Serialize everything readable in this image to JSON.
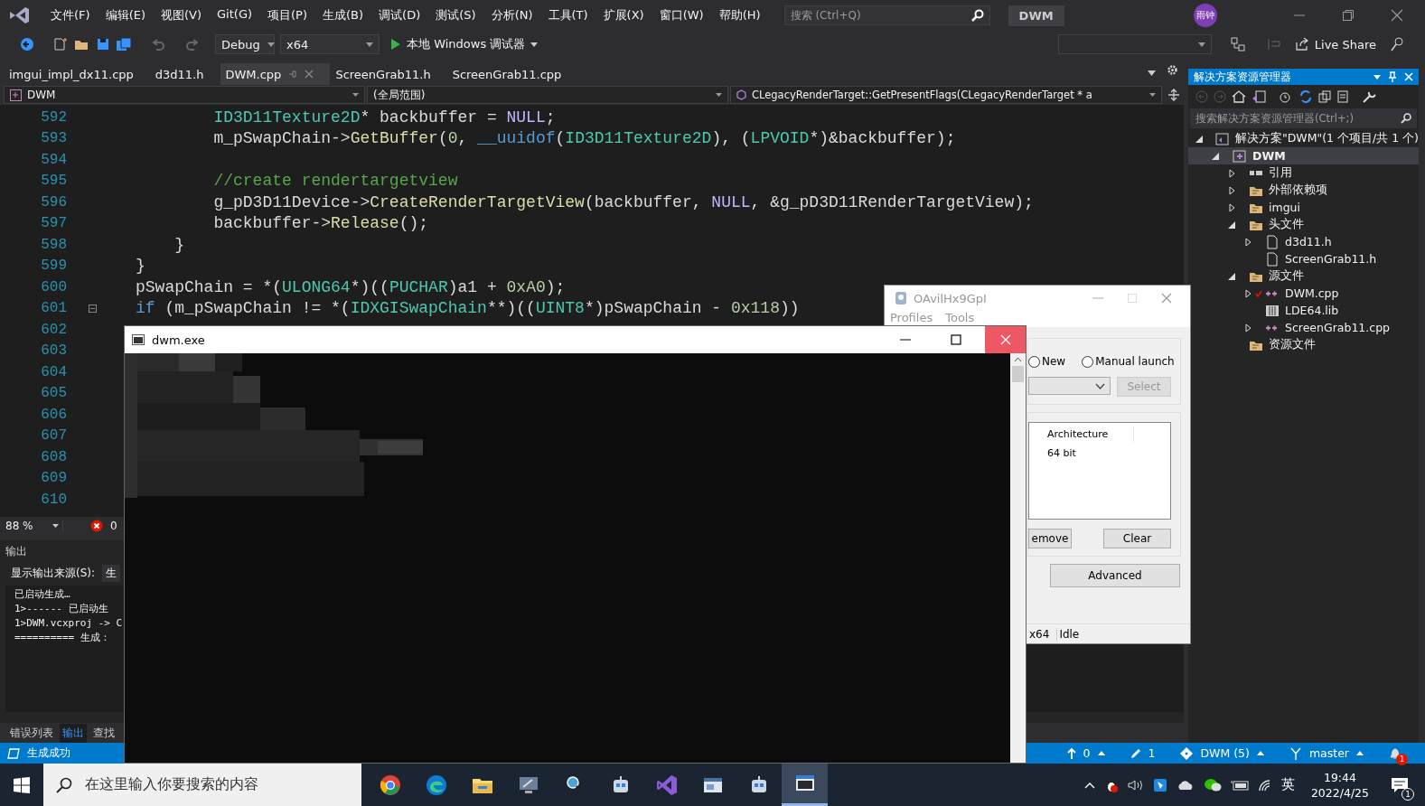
{
  "menu": [
    "文件(F)",
    "编辑(E)",
    "视图(V)",
    "Git(G)",
    "项目(P)",
    "生成(B)",
    "调试(D)",
    "测试(S)",
    "分析(N)",
    "工具(T)",
    "扩展(X)",
    "窗口(W)",
    "帮助(H)"
  ],
  "search": {
    "placeholder": "搜索 (Ctrl+Q)"
  },
  "solution_name": "DWM",
  "user_badge": "雨钟",
  "toolbar": {
    "configuration": "Debug",
    "platform": "x64",
    "run": "本地 Windows 调试器",
    "live_share": "Live Share"
  },
  "tabs": [
    {
      "label": "imgui_impl_dx11.cpp",
      "selected": false
    },
    {
      "label": "d3d11.h",
      "selected": false
    },
    {
      "label": "DWM.cpp",
      "selected": true
    },
    {
      "label": "ScreenGrab11.h",
      "selected": false
    },
    {
      "label": "ScreenGrab11.cpp",
      "selected": false
    }
  ],
  "nav": {
    "project": "DWM",
    "scope": "(全局范围)",
    "member": "CLegacyRenderTarget::GetPresentFlags(CLegacyRenderTarget * a"
  },
  "code": [
    {
      "number": "592",
      "segments": [
        {
          "kind": "type",
          "text": "        ID3D11Texture2D"
        },
        {
          "kind": "plain",
          "text": "* "
        },
        {
          "kind": "var",
          "text": "backbuffer"
        },
        {
          "kind": "plain",
          "text": " = "
        },
        {
          "kind": "macro",
          "text": "NULL"
        },
        {
          "kind": "plain",
          "text": ";"
        }
      ]
    },
    {
      "number": "593",
      "segments": [
        {
          "kind": "var",
          "text": "        m_pSwapChain"
        },
        {
          "kind": "plain",
          "text": "->"
        },
        {
          "kind": "fn",
          "text": "GetBuffer"
        },
        {
          "kind": "plain",
          "text": "("
        },
        {
          "kind": "num",
          "text": "0"
        },
        {
          "kind": "plain",
          "text": ", "
        },
        {
          "kind": "kw",
          "text": "__uuidof"
        },
        {
          "kind": "plain",
          "text": "("
        },
        {
          "kind": "type",
          "text": "ID3D11Texture2D"
        },
        {
          "kind": "plain",
          "text": "), ("
        },
        {
          "kind": "type",
          "text": "LPVOID"
        },
        {
          "kind": "plain",
          "text": "*)&"
        },
        {
          "kind": "var",
          "text": "backbuffer"
        },
        {
          "kind": "plain",
          "text": ");"
        }
      ]
    },
    {
      "number": "594"
    },
    {
      "number": "595",
      "segments": [
        {
          "kind": "comment",
          "text": "        //create rendertargetview"
        }
      ]
    },
    {
      "number": "596",
      "segments": [
        {
          "kind": "var",
          "text": "        g_pD3D11Device"
        },
        {
          "kind": "plain",
          "text": "->"
        },
        {
          "kind": "fn",
          "text": "CreateRenderTargetView"
        },
        {
          "kind": "plain",
          "text": "("
        },
        {
          "kind": "var",
          "text": "backbuffer"
        },
        {
          "kind": "plain",
          "text": ", "
        },
        {
          "kind": "macro",
          "text": "NULL"
        },
        {
          "kind": "plain",
          "text": ", &"
        },
        {
          "kind": "var",
          "text": "g_pD3D11RenderTargetView"
        },
        {
          "kind": "plain",
          "text": ");"
        }
      ]
    },
    {
      "number": "597",
      "segments": [
        {
          "kind": "var",
          "text": "        backbuffer"
        },
        {
          "kind": "plain",
          "text": "->"
        },
        {
          "kind": "fn",
          "text": "Release"
        },
        {
          "kind": "plain",
          "text": "();"
        }
      ]
    },
    {
      "number": "598",
      "segments": [
        {
          "kind": "plain",
          "text": "    }"
        }
      ]
    },
    {
      "number": "599",
      "segments": [
        {
          "kind": "plain",
          "text": "}"
        }
      ]
    },
    {
      "number": "600",
      "segments": [
        {
          "kind": "var",
          "text": "pSwapChain"
        },
        {
          "kind": "plain",
          "text": " = *("
        },
        {
          "kind": "type",
          "text": "ULONG64"
        },
        {
          "kind": "plain",
          "text": "*)(("
        },
        {
          "kind": "type",
          "text": "PUCHAR"
        },
        {
          "kind": "plain",
          "text": ")"
        },
        {
          "kind": "var",
          "text": "a1"
        },
        {
          "kind": "plain",
          "text": " + "
        },
        {
          "kind": "num",
          "text": "0xA0"
        },
        {
          "kind": "plain",
          "text": ");"
        }
      ]
    },
    {
      "number": "601",
      "segments": [
        {
          "kind": "kw",
          "text": "if"
        },
        {
          "kind": "plain",
          "text": " ("
        },
        {
          "kind": "var",
          "text": "m_pSwapChain"
        },
        {
          "kind": "plain",
          "text": " != *("
        },
        {
          "kind": "type",
          "text": "IDXGISwapChain"
        },
        {
          "kind": "plain",
          "text": "**)(("
        },
        {
          "kind": "type",
          "text": "UINT8"
        },
        {
          "kind": "plain",
          "text": "*)"
        },
        {
          "kind": "var",
          "text": "pSwapChain"
        },
        {
          "kind": "plain",
          "text": " - "
        },
        {
          "kind": "num",
          "text": "0x118"
        },
        {
          "kind": "plain",
          "text": "))"
        }
      ]
    },
    {
      "number": "602"
    },
    {
      "number": "603"
    },
    {
      "number": "604"
    },
    {
      "number": "605"
    },
    {
      "number": "606"
    },
    {
      "number": "607"
    },
    {
      "number": "608"
    },
    {
      "number": "609"
    },
    {
      "number": "610"
    }
  ],
  "zoom": "88 %",
  "errors": "0",
  "output": {
    "title": "输出",
    "source_label": "显示输出来源(S):",
    "source": "生",
    "lines": [
      "已启动生成…",
      "1>------ 已启动生",
      "1>DWM.vcxproj -> C",
      "========== 生成："
    ]
  },
  "bottom_tabs": [
    {
      "label": "错误列表",
      "selected": false
    },
    {
      "label": "输出",
      "selected": true
    },
    {
      "label": "查找",
      "selected": false
    }
  ],
  "status_bar": {
    "message": "生成成功",
    "push": "0",
    "changes": "1",
    "repo": "DWM (5)",
    "branch": "master",
    "notifications": "1"
  },
  "explorer": {
    "title": "解决方案资源管理器",
    "search": {
      "placeholder": "搜索解决方案资源管理器(Ctrl+;)"
    },
    "tree": [
      {
        "label": "解决方案\"DWM\"(1 个项目/共 1 个)",
        "kind": "solution",
        "expanded": true,
        "selected": false,
        "children": [
          {
            "label": "DWM",
            "kind": "project",
            "expanded": true,
            "selected": true,
            "children": [
              {
                "label": "引用",
                "kind": "references",
                "expanded": false,
                "selected": false
              },
              {
                "label": "外部依赖项",
                "kind": "folder",
                "expanded": false,
                "selected": false
              },
              {
                "label": "imgui",
                "kind": "folder",
                "expanded": false,
                "selected": false
              },
              {
                "label": "头文件",
                "kind": "folder",
                "expanded": true,
                "selected": false,
                "children": [
                  {
                    "label": "d3d11.h",
                    "kind": "header",
                    "expanded": false,
                    "selected": false
                  },
                  {
                    "label": "ScreenGrab11.h",
                    "kind": "header",
                    "selected": false
                  }
                ]
              },
              {
                "label": "源文件",
                "kind": "folder",
                "expanded": true,
                "selected": false,
                "children": [
                  {
                    "label": "DWM.cpp",
                    "kind": "cpp",
                    "expanded": false,
                    "selected": false,
                    "modified": true
                  },
                  {
                    "label": "LDE64.lib",
                    "kind": "lib",
                    "selected": false
                  },
                  {
                    "label": "ScreenGrab11.cpp",
                    "kind": "cpp",
                    "expanded": false,
                    "selected": false
                  }
                ]
              },
              {
                "label": "资源文件",
                "kind": "folder",
                "selected": false
              }
            ]
          }
        ]
      }
    ]
  },
  "injector_window": {
    "title": "OAvilHx9GpI",
    "menu": [
      "Profiles",
      "Tools"
    ],
    "radios": [
      {
        "label": "New",
        "selected": false
      },
      {
        "label": "Manual launch",
        "selected": false
      }
    ],
    "select_button": {
      "label": "Select",
      "disabled": true
    },
    "list": {
      "column": "Architecture",
      "value": "64 bit"
    },
    "buttons": [
      "emove",
      "Clear"
    ],
    "advanced": "Advanced",
    "status": [
      "x64",
      "Idle"
    ]
  },
  "console_window": {
    "title": "dwm.exe"
  },
  "taskbar": {
    "search_placeholder": "在这里输入你要搜索的内容",
    "apps": [
      {
        "kind": "chrome",
        "active": false
      },
      {
        "kind": "edge",
        "active": false
      },
      {
        "kind": "folder",
        "active": false
      },
      {
        "kind": "tool",
        "active": false
      },
      {
        "kind": "search",
        "active": false
      },
      {
        "kind": "robot",
        "active": false
      },
      {
        "kind": "vs",
        "active": false
      },
      {
        "kind": "window",
        "active": false
      },
      {
        "kind": "robot",
        "active": false
      },
      {
        "kind": "console",
        "active": true
      }
    ],
    "ime": "英",
    "time": "19:44",
    "date": "2022/4/25",
    "notifications": "1"
  }
}
